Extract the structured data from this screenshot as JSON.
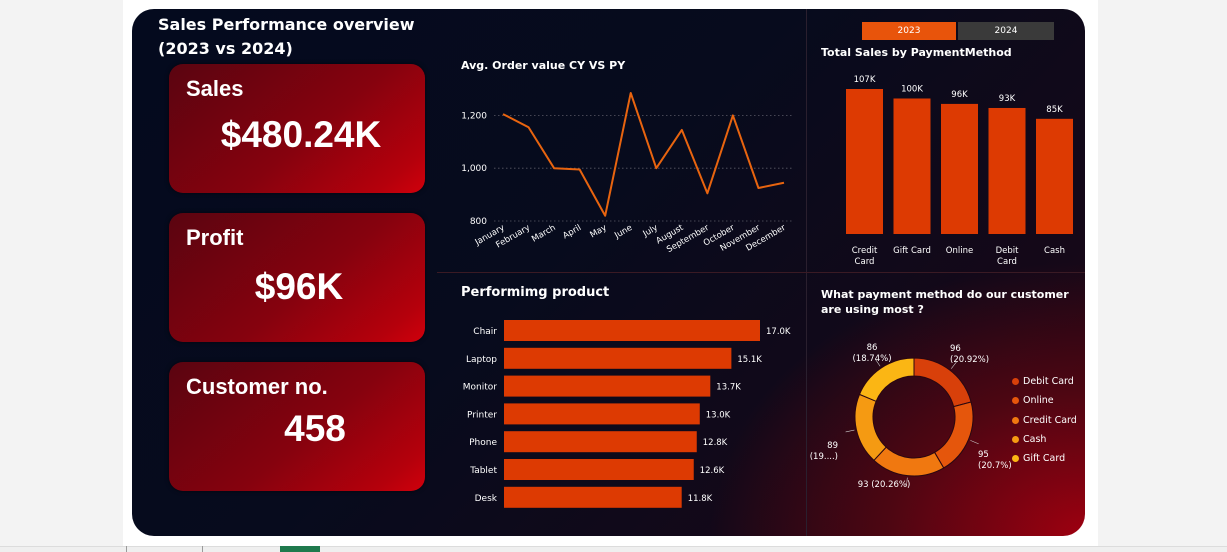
{
  "dashboard": {
    "title_line1": "Sales Performance overview",
    "title_line2": "(2023 vs 2024)"
  },
  "kpis": [
    {
      "label": "Sales",
      "value": "$480.24K"
    },
    {
      "label": "Profit",
      "value": "$96K"
    },
    {
      "label": "Customer no.",
      "value": "458"
    }
  ],
  "year_toggle": {
    "options": [
      "2023",
      "2024"
    ],
    "selected": "2023"
  },
  "colors": {
    "line": "#e8640f",
    "bar": "#dd3a02",
    "kpi": "#b5000c",
    "donut": [
      "#d8400a",
      "#e5560c",
      "#f07810",
      "#f59a12",
      "#fbb614"
    ]
  },
  "chart_data": [
    {
      "type": "line",
      "title": "Avg. Order value CY VS PY",
      "x": [
        "January",
        "February",
        "March",
        "April",
        "May",
        "June",
        "July",
        "August",
        "September",
        "October",
        "November",
        "December"
      ],
      "series": [
        {
          "values": [
            1205,
            1155,
            1000,
            995,
            820,
            1285,
            1000,
            1145,
            905,
            1200,
            925,
            945
          ]
        }
      ],
      "yticks": [
        800,
        1000,
        1200
      ],
      "ytick_labels": [
        "800",
        "1,000",
        "1,200"
      ],
      "ylim": [
        800,
        1300
      ],
      "grid": true
    },
    {
      "type": "bar",
      "title": "Total Sales by PaymentMethod",
      "categories": [
        "Credit\nCard",
        "Gift Card",
        "Online",
        "Debit\nCard",
        "Cash"
      ],
      "values": [
        107,
        100,
        96,
        93,
        85
      ],
      "data_labels": [
        "107K",
        "100K",
        "96K",
        "93K",
        "85K"
      ],
      "ylim": [
        0,
        107
      ]
    },
    {
      "type": "bar",
      "orientation": "horizontal",
      "title": "Performimg product",
      "categories": [
        "Chair",
        "Laptop",
        "Monitor",
        "Printer",
        "Phone",
        "Tablet",
        "Desk"
      ],
      "values": [
        17.0,
        15.1,
        13.7,
        13.0,
        12.8,
        12.6,
        11.8
      ],
      "data_labels": [
        "17.0K",
        "15.1K",
        "13.7K",
        "13.0K",
        "12.8K",
        "12.6K",
        "11.8K"
      ],
      "xlim": [
        0,
        17.0
      ]
    },
    {
      "type": "pie",
      "title": "What payment method do our customer are using most ?",
      "categories": [
        "Debit Card",
        "Online",
        "Credit Card",
        "Cash",
        "Gift Card"
      ],
      "values": [
        96,
        95,
        93,
        89,
        86
      ],
      "labels": [
        [
          "96",
          "(20.92%)"
        ],
        [
          "95",
          "(20.7%)"
        ],
        [
          "93 (20.26%)"
        ],
        [
          "89",
          "(19....)"
        ],
        [
          "86",
          "(18.74%)"
        ]
      ],
      "legend": "right"
    }
  ]
}
